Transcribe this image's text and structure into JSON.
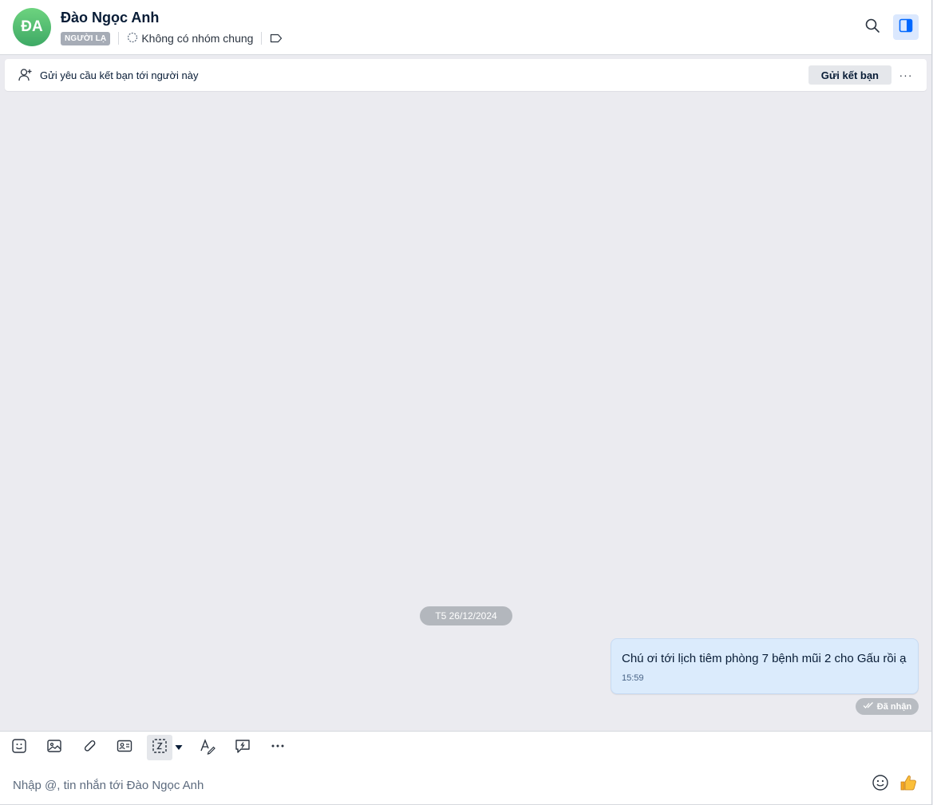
{
  "header": {
    "avatar_initials": "ĐA",
    "name": "Đào Ngọc Anh",
    "badge": "NGƯỜI LẠ",
    "group_text": "Không có nhóm chung",
    "icons": [
      "search-icon",
      "sidebar-toggle-icon",
      "group-icon",
      "tag-icon"
    ]
  },
  "friend_bar": {
    "text": "Gửi yêu cầu kết bạn tới người này",
    "button": "Gửi kết bạn",
    "more": "···"
  },
  "messages": {
    "date_divider": "T5 26/12/2024",
    "items": [
      {
        "text": "Chú ơi tới lịch tiêm phòng 7 bệnh mũi 2 cho Gấu rồi ạ",
        "time": "15:59",
        "direction": "outgoing"
      }
    ],
    "status": "Đã nhận"
  },
  "toolbar": {
    "tools": [
      "sticker-icon",
      "image-icon",
      "attachment-icon",
      "contact-card-icon",
      "screenshot-icon",
      "format-text-icon",
      "quick-message-icon",
      "more-icon"
    ]
  },
  "composer": {
    "placeholder": "Nhập @, tin nhắn tới Đào Ngọc Anh"
  },
  "colors": {
    "accent": "#0068ff",
    "bubble": "#dbebfc",
    "chat_bg": "#ebebf0"
  }
}
